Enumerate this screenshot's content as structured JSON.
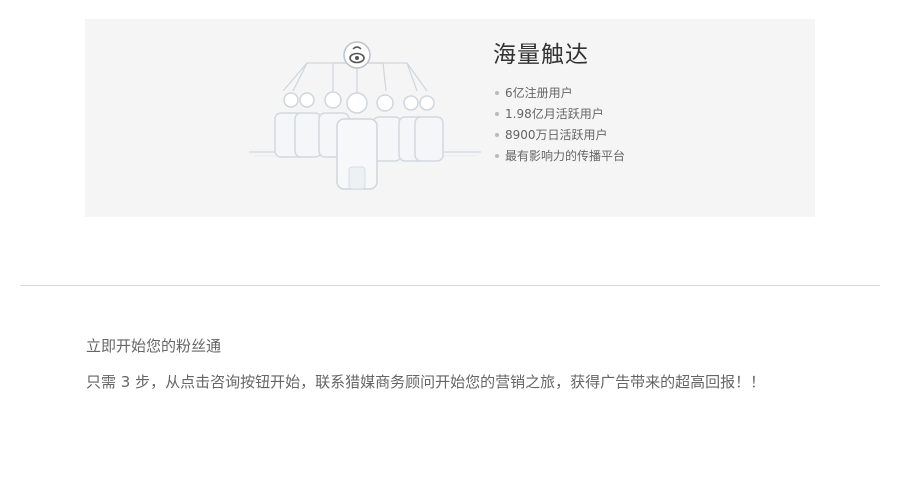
{
  "feature": {
    "title": "海量触达",
    "points": [
      "6亿注册用户",
      "1.98亿月活跃用户",
      "8900万日活跃用户",
      "最有影响力的传播平台"
    ],
    "logo_icon": "weibo-eye-icon",
    "illustration_icon": "people-network-icon"
  },
  "intro": {
    "heading": "立即开始您的粉丝通",
    "body": "只需 3 步，从点击咨询按钮开始，联系猎媒商务顾问开始您的营销之旅，获得广告带来的超高回报！！"
  },
  "colors": {
    "panel_bg": "#f5f5f5",
    "title_text": "#333333",
    "body_text": "#666666"
  }
}
